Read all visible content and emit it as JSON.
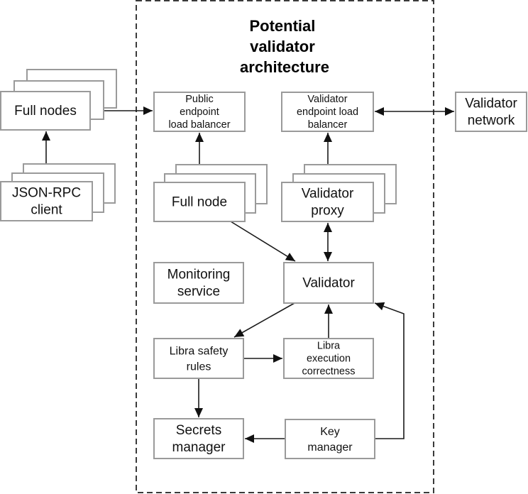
{
  "title": [
    "Potential",
    "validator",
    "architecture"
  ],
  "nodes": {
    "full_nodes": {
      "label": [
        "Full nodes"
      ],
      "stacked": true
    },
    "json_rpc_client": {
      "label": [
        "JSON-RPC",
        "client"
      ],
      "stacked": true
    },
    "public_lb": {
      "label": [
        "Public",
        "endpoint",
        "load balancer"
      ],
      "stacked": false
    },
    "validator_lb": {
      "label": [
        "Validator",
        "endpoint load",
        "balancer"
      ],
      "stacked": false
    },
    "validator_network": {
      "label": [
        "Validator",
        "network"
      ],
      "stacked": false
    },
    "full_node": {
      "label": [
        "Full node"
      ],
      "stacked": true
    },
    "validator_proxy": {
      "label": [
        "Validator",
        "proxy"
      ],
      "stacked": true
    },
    "monitoring": {
      "label": [
        "Monitoring",
        "service"
      ],
      "stacked": false
    },
    "validator": {
      "label": [
        "Validator"
      ],
      "stacked": false
    },
    "safety_rules": {
      "label": [
        "Libra safety",
        "rules"
      ],
      "stacked": false
    },
    "execution_correctness": {
      "label": [
        "Libra",
        "execution",
        "correctness"
      ],
      "stacked": false
    },
    "secrets_manager": {
      "label": [
        "Secrets",
        "manager"
      ],
      "stacked": false
    },
    "key_manager": {
      "label": [
        "Key",
        "manager"
      ],
      "stacked": false
    }
  },
  "edges": [
    {
      "from": "json_rpc_client",
      "to": "full_nodes",
      "direction": "forward"
    },
    {
      "from": "full_nodes",
      "to": "public_lb",
      "direction": "forward"
    },
    {
      "from": "public_lb",
      "to": "full_node",
      "direction": "both"
    },
    {
      "from": "validator_lb",
      "to": "validator_network",
      "direction": "both"
    },
    {
      "from": "validator_lb",
      "to": "validator_proxy",
      "direction": "both"
    },
    {
      "from": "full_node",
      "to": "validator",
      "direction": "forward"
    },
    {
      "from": "validator_proxy",
      "to": "validator",
      "direction": "both"
    },
    {
      "from": "validator",
      "to": "safety_rules",
      "direction": "forward"
    },
    {
      "from": "execution_correctness",
      "to": "validator",
      "direction": "forward"
    },
    {
      "from": "safety_rules",
      "to": "execution_correctness",
      "direction": "forward"
    },
    {
      "from": "safety_rules",
      "to": "secrets_manager",
      "direction": "forward"
    },
    {
      "from": "key_manager",
      "to": "secrets_manager",
      "direction": "forward"
    },
    {
      "from": "key_manager",
      "to": "validator",
      "direction": "forward"
    }
  ]
}
